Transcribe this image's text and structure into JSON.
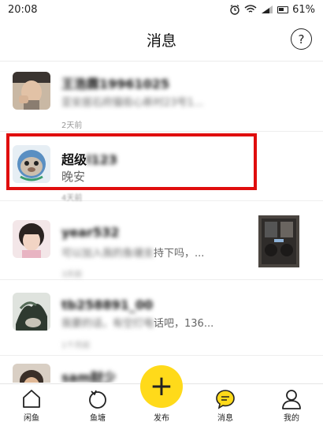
{
  "statusbar": {
    "time": "20:08",
    "battery": "61%"
  },
  "header": {
    "title": "消息",
    "help_label": "?"
  },
  "messages": [
    {
      "name": "王浩霖19961025",
      "preview": "亚安居石府猫街心新村23号1...",
      "time": "2天前"
    },
    {
      "name_visible": "超级",
      "name_blurred": "l123",
      "preview": "晚安",
      "time": "4天前"
    },
    {
      "name": "year532",
      "preview_blurred": "可以加入我的鱼塘支",
      "preview_visible": "持下吗，...",
      "time": "3天前"
    },
    {
      "name": "tb258891_00",
      "preview_blurred": "我要的话，有空打电",
      "preview_visible": "话吧，136...",
      "time": "1个月前"
    },
    {
      "name": "sam财少"
    }
  ],
  "tabs": [
    {
      "label": "闲鱼",
      "icon": "home-icon"
    },
    {
      "label": "鱼塘",
      "icon": "pond-icon"
    },
    {
      "label": "发布",
      "icon": "plus-icon",
      "symbol": "+"
    },
    {
      "label": "消息",
      "icon": "message-icon"
    },
    {
      "label": "我的",
      "icon": "profile-icon"
    }
  ],
  "colors": {
    "accent": "#ffda1a",
    "highlight_box": "#e00d0d"
  }
}
